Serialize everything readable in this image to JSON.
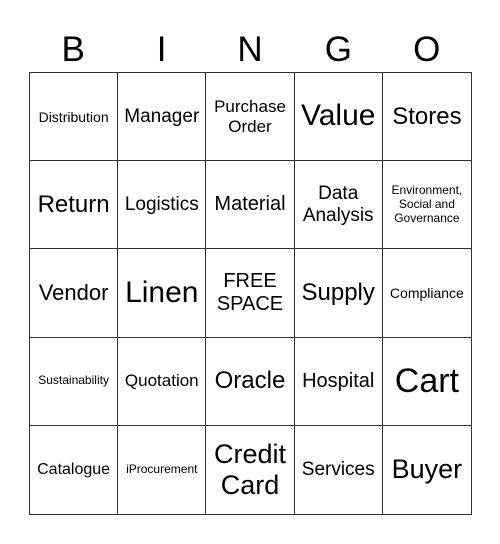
{
  "header": {
    "letters": [
      "B",
      "I",
      "N",
      "G",
      "O"
    ]
  },
  "cells": [
    "Distribution",
    "Manager",
    "Purchase Order",
    "Value",
    "Stores",
    "Return",
    "Logistics",
    "Material",
    "Data Analysis",
    "Environment, Social and Governance",
    "Vendor",
    "Linen",
    "FREE SPACE",
    "Supply",
    "Compliance",
    "Sustainability",
    "Quotation",
    "Oracle",
    "Hospital",
    "Cart",
    "Catalogue",
    "iProcurement",
    "Credit Card",
    "Services",
    "Buyer"
  ]
}
